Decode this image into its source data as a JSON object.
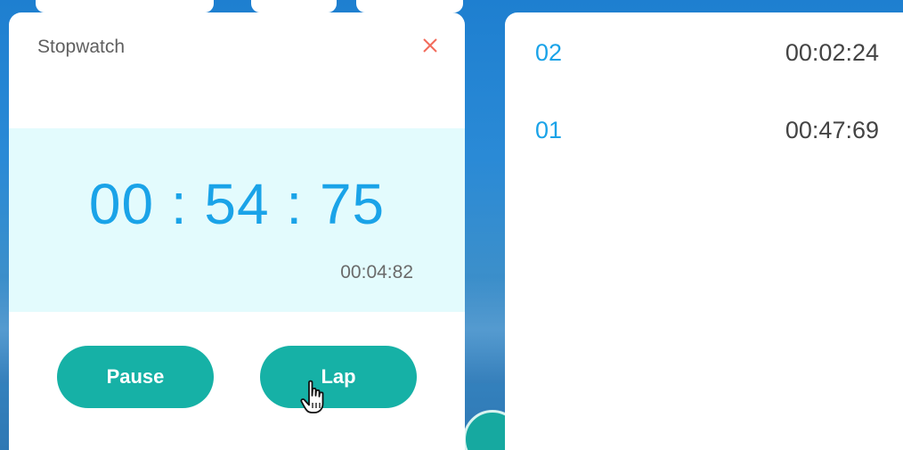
{
  "stopwatch": {
    "title": "Stopwatch",
    "close_icon": "close-icon",
    "main_time": "00 : 54 : 75",
    "current_lap_time": "00:04:82",
    "pause_label": "Pause",
    "lap_label": "Lap"
  },
  "laps": [
    {
      "number": "02",
      "time": "00:02:24"
    },
    {
      "number": "01",
      "time": "00:47:69"
    }
  ],
  "colors": {
    "accent_blue": "#1aa3e8",
    "button_teal": "#16b1a6",
    "close_red": "#f26b5b",
    "timer_band": "#e3fbfd"
  },
  "icons": {
    "cursor": "hand-pointer-icon"
  }
}
